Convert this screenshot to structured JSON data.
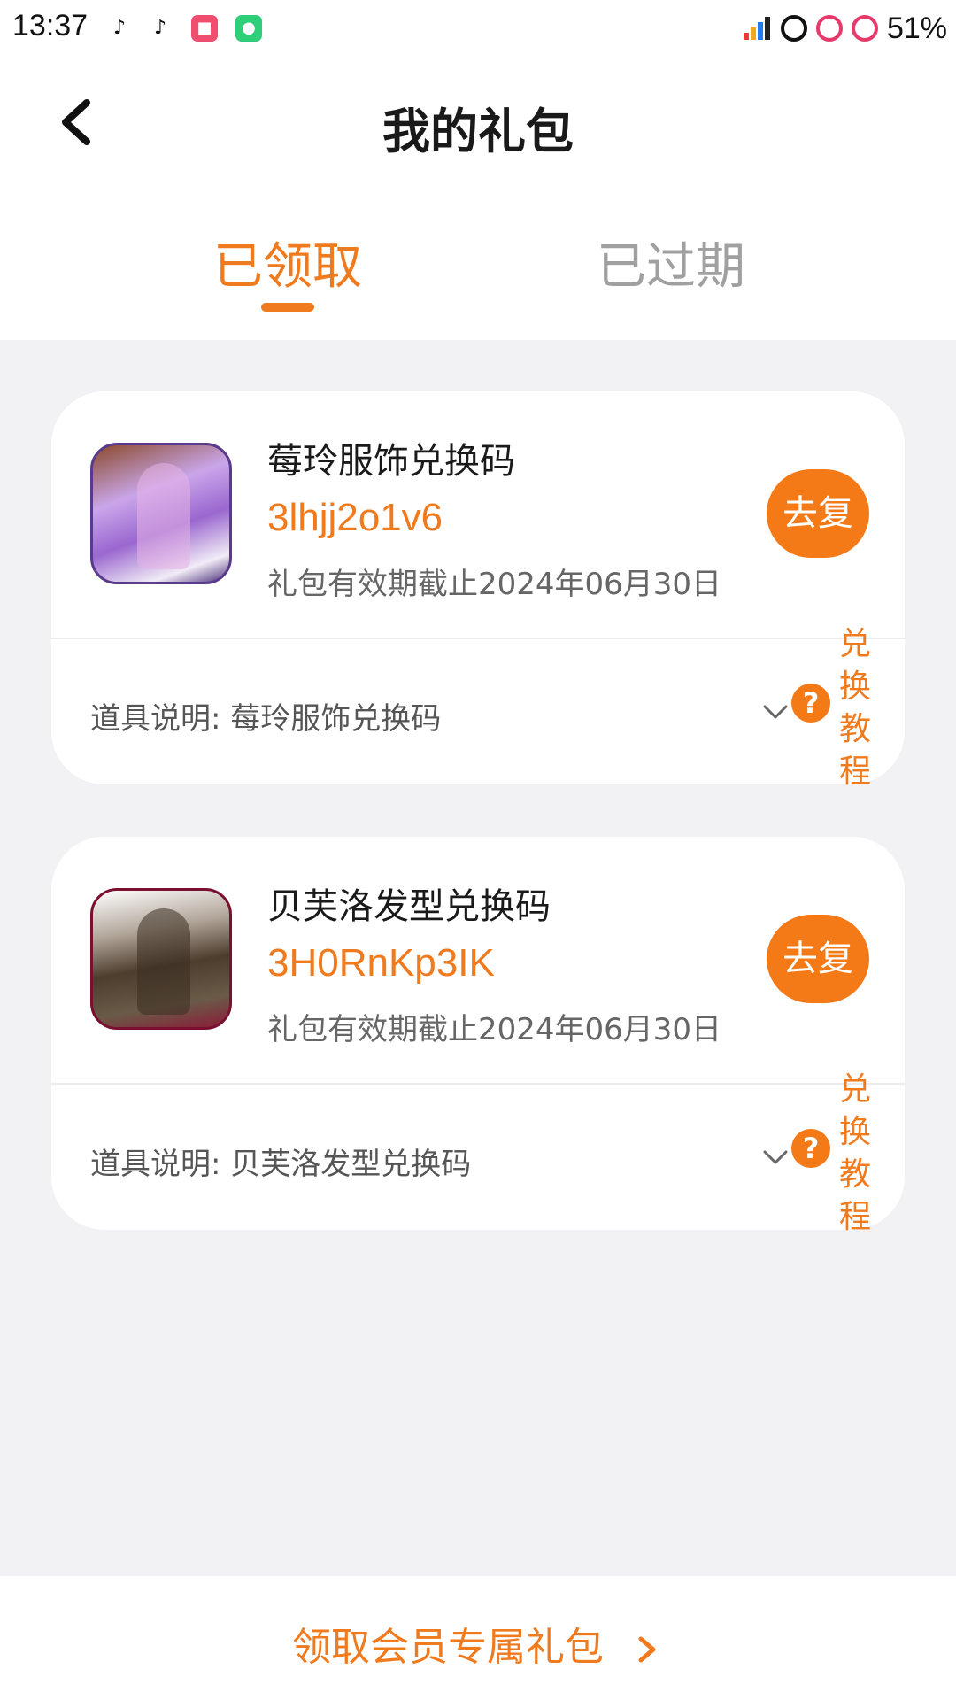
{
  "status_bar": {
    "time": "13:37",
    "battery": "51%"
  },
  "header": {
    "title": "我的礼包",
    "back_icon": "back-arrow-icon"
  },
  "tabs": [
    {
      "label": "已领取",
      "active": true
    },
    {
      "label": "已过期",
      "active": false
    }
  ],
  "gifts": [
    {
      "name": "莓玲服饰兑换码",
      "code": "3lhjj2o1v6",
      "expiry": "礼包有效期截止2024年06月30日",
      "copy_label": "去复",
      "description": "道具说明: 莓玲服饰兑换码",
      "help_icon": "question-icon",
      "tutorial_label": "兑换教程"
    },
    {
      "name": "贝芙洛发型兑换码",
      "code": "3H0RnKp3IK",
      "expiry": "礼包有效期截止2024年06月30日",
      "copy_label": "去复",
      "description": "道具说明: 贝芙洛发型兑换码",
      "help_icon": "question-icon",
      "tutorial_label": "兑换教程"
    }
  ],
  "bottom": {
    "member_gift_label": "领取会员专属礼包"
  },
  "colors": {
    "accent": "#f07a1e",
    "background": "#f2f2f4",
    "card": "#ffffff"
  }
}
